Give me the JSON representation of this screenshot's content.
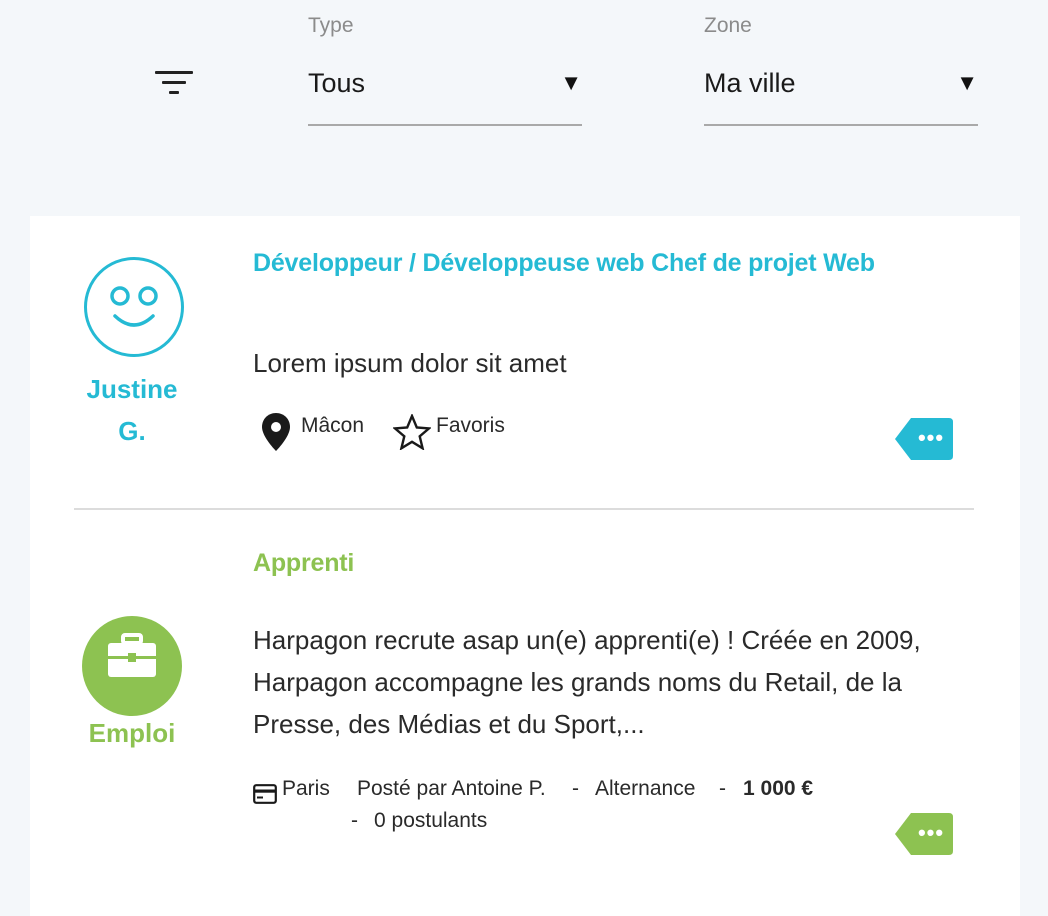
{
  "filters": {
    "type": {
      "label": "Type",
      "value": "Tous"
    },
    "zone": {
      "label": "Zone",
      "value": "Ma ville"
    }
  },
  "listings": [
    {
      "author": "Justine G.",
      "author_line1": "Justine",
      "author_line2": "G.",
      "title": "Développeur / Développeuse web Chef de projet Web",
      "description": "Lorem ipsum dolor sit amet",
      "location": "Mâcon",
      "favorite_label": "Favoris",
      "more": "•••",
      "accent": "#25bad4"
    },
    {
      "category": "Emploi",
      "title": "Apprenti",
      "description_lines": [
        "Harpagon recrute asap un(e) apprenti(e) ! Créée en 2009,",
        "Harpagon accompagne les grands noms du Retail, de la",
        "Presse, des Médias et du Sport,..."
      ],
      "location": "Paris",
      "posted_by": "Posté par Antoine P.",
      "sep1": "-",
      "contract": "Alternance",
      "sep2": "-",
      "salary": "1 000 €",
      "sep3": "-",
      "applicants": "0 postulants",
      "more": "•••",
      "accent": "#8dc251"
    }
  ]
}
